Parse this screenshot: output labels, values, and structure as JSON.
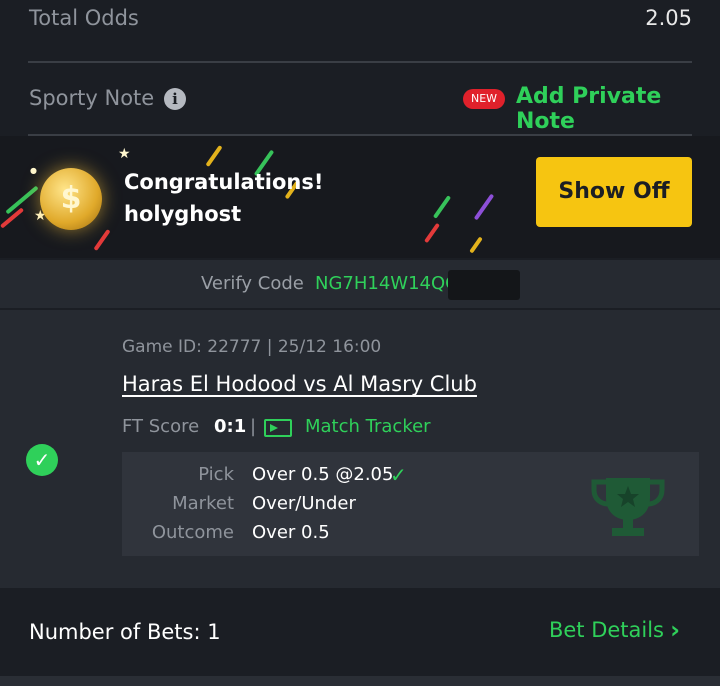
{
  "total_odds": {
    "label": "Total Odds",
    "value": "2.05"
  },
  "sporty_note": {
    "label": "Sporty Note",
    "new_badge": "NEW",
    "add_note": "Add Private Note"
  },
  "banner": {
    "line1": "Congratulations!",
    "line2": "holyghost",
    "button": "Show Off",
    "coin_symbol": "$"
  },
  "verify": {
    "label": "Verify Code",
    "code": "NG7H14W14QC"
  },
  "game": {
    "game_id": "Game ID: 22777 | 25/12 16:00",
    "match": "Haras El Hodood vs Al Masry Club",
    "ft_score_label": "FT Score",
    "ft_score": "0:1",
    "separator": "|",
    "tracker": "Match Tracker",
    "pick_label": "Pick",
    "pick_value": "Over 0.5 @2.05",
    "market_label": "Market",
    "market_value": "Over/Under",
    "outcome_label": "Outcome",
    "outcome_value": "Over 0.5"
  },
  "footer": {
    "bets": "Number of Bets: 1",
    "details": "Bet Details"
  },
  "colors": {
    "accent_green": "#2fd05a",
    "button_yellow": "#f6c511",
    "badge_red": "#e0212b"
  }
}
